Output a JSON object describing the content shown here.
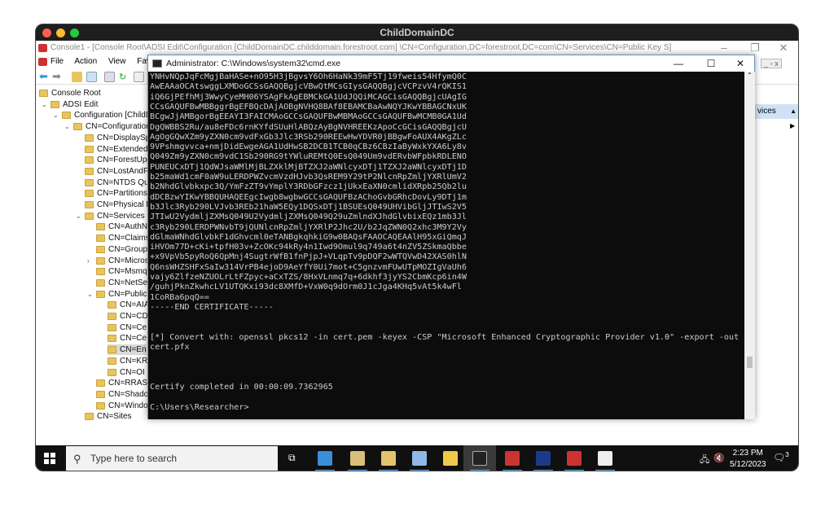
{
  "mac": {
    "title": "ChildDomainDC"
  },
  "console": {
    "title": "Console1 - [Console Root\\ADSI Edit\\Configuration [ChildDomainDC.childdomain.forestroot.com] \\CN=Configuration,DC=forestroot,DC=com\\CN=Services\\CN=Public Key S]",
    "menu": [
      "File",
      "Action",
      "View",
      "Favor"
    ],
    "right_panel_header": "vices",
    "tree": [
      {
        "label": "Console Root",
        "indent": 0,
        "chev": ""
      },
      {
        "label": "ADSI Edit",
        "indent": 1,
        "chev": "v"
      },
      {
        "label": "Configuration [ChildDomainDC",
        "indent": 2,
        "chev": "v"
      },
      {
        "label": "CN=Configuration",
        "indent": 3,
        "chev": "v"
      },
      {
        "label": "CN=DisplaySp",
        "indent": 4,
        "chev": ""
      },
      {
        "label": "CN=Extended-",
        "indent": 4,
        "chev": ""
      },
      {
        "label": "CN=ForestUpd",
        "indent": 4,
        "chev": ""
      },
      {
        "label": "CN=LostAndF",
        "indent": 4,
        "chev": ""
      },
      {
        "label": "CN=NTDS Quo",
        "indent": 4,
        "chev": ""
      },
      {
        "label": "CN=Partitions",
        "indent": 4,
        "chev": ""
      },
      {
        "label": "CN=Physical L",
        "indent": 4,
        "chev": ""
      },
      {
        "label": "CN=Services",
        "indent": 4,
        "chev": "v"
      },
      {
        "label": "CN=AuthN",
        "indent": 5,
        "chev": ""
      },
      {
        "label": "CN=Claims",
        "indent": 5,
        "chev": ""
      },
      {
        "label": "CN=Group",
        "indent": 5,
        "chev": ""
      },
      {
        "label": "CN=Micros",
        "indent": 5,
        "chev": ">"
      },
      {
        "label": "CN=Msmq",
        "indent": 5,
        "chev": ""
      },
      {
        "label": "CN=NetSer",
        "indent": 5,
        "chev": ""
      },
      {
        "label": "CN=Public",
        "indent": 5,
        "chev": "v"
      },
      {
        "label": "CN=AIA",
        "indent": 6,
        "chev": ""
      },
      {
        "label": "CN=CD",
        "indent": 6,
        "chev": ""
      },
      {
        "label": "CN=Ce",
        "indent": 6,
        "chev": ""
      },
      {
        "label": "CN=Ce",
        "indent": 6,
        "chev": ""
      },
      {
        "label": "CN=En",
        "indent": 6,
        "chev": "",
        "selected": true
      },
      {
        "label": "CN=KR",
        "indent": 6,
        "chev": ""
      },
      {
        "label": "CN=OI",
        "indent": 6,
        "chev": ""
      },
      {
        "label": "CN=RRAS",
        "indent": 5,
        "chev": ""
      },
      {
        "label": "CN=Shado",
        "indent": 5,
        "chev": ""
      },
      {
        "label": "CN=Windo",
        "indent": 5,
        "chev": ""
      },
      {
        "label": "CN=Sites",
        "indent": 4,
        "chev": ""
      }
    ]
  },
  "cmd": {
    "title": "Administrator: C:\\Windows\\system32\\cmd.exe",
    "lines": [
      "YNHvNQpJqFcMgjBaHASe+nO95H3jBgvsY6Oh6HaNk39mF5Tj19fweis54HfymQ0C",
      "AwEAAaOCAtswggLXMDoGCSsGAQQBgjcVBwQtMCsGIysGAQQBgjcVCPzvV4rQKIS1",
      "iQ6GjPEfhMj3WwyCyeMH06YSAgFkAgEBMCkGA1UdJQQiMCAGCisGAQQBgjcUAgIG",
      "CCsGAQUFBwMBBggrBgEFBQcDAjAOBgNVHQ8BAf8EBAMCBaAwNQYJKwYBBAGCNxUK",
      "BCgwJjAMBgorBgEEAYI3FAICMAoGCCsGAQUFBwMBMAoGCCsGAQUFBwMCMB0GA1Ud",
      "DgQWBBS2Ru/au8eFDc6rnKYfdSUuHlABQzAyBgNVHREEKzApoCcGCisGAQQBgjcU",
      "AgOgGQwXZm9yZXN0cm9vdFxGb3Jlc3RSb290REEwHwYDVR0jBBgwFoAUX4AKgZLc",
      "9VPshmgvvca+nmjDidEwgeAGA1UdHwSB2DCB1TCB0qCBz6CBzIaByWxkYXA6Ly8v",
      "Q049Zm9yZXN0cm9vdC1Sb290RG9tYWluREMtQ0EsQ049Um9vdERvbWFpbkRDLENO",
      "PUNEUCxDTj1QdWJsaWMlMjBLZXklMjBTZXJ2aWNlcyxDTj1TZXJ2aWNlcyxDTj1D",
      "b25maWd1cmF0aW9uLERDPWZvcmVzdHJvb3QsREM9Y29tP2NlcnRpZmljYXRlUmV2",
      "b2NhdGlvbkxpc3Q/YmFzZT9vYmplY3RDbGFzcz1jUkxEaXN0cmlidXRpb25Qb2lu",
      "dDCBzwYIKwYBBQUHAQEEgcIwgb8wgbwGCCsGAQUFBzAChoGvbGRhcDovLy9DTj1m",
      "b3Jlc3Ryb290LVJvb3REb21haW5EQy1DQSxDTj1BSUEsQ049UHVibGljJTIwS2V5",
      "JTIwU2VydmljZXMsQ049U2VydmljZXMsQ049Q29uZmlndXJhdGlvbixEQz1mb3Jl",
      "c3Ryb290LERDPWNvbT9jQUNlcnRpZmljYXRlP2Jhc2U/b2JqZWN0Q2xhc3M9Y2Vy",
      "dGlmaWNhdGlvbkF1dGhvcml0eTANBgkqhkiG9w0BAQsFAAOCAQEAAlH95xGiQmqJ",
      "iHVOm77D+cKi+tpfH03v+ZcOKc94kRy4n1Iwd9Omul9q749a6t4nZV5ZSkmaQbbe",
      "+x9VpVb5pyRoQ6QpMnj4SugtrWfB1fnPjpJ+VLqpTv9pDQF2wWTQVwD42XAS0hlN",
      "Q6nsWHZSHFxSaIw314VrPB4ejoD9AeYfY0Ui7mot+C5gnzvmFUwUTpMOZIgVaUh6",
      "vajy6ZlfzeNZUOLrLtFZpyc+aCxTZS/8HxVLnmq7q+6dkhf3jyYS2CbmKcp6in4W",
      "/guhjPknZkwhcLV1UTQKxi93dc8XMfD+VxW0q9dOrm0J1cJga4KHq5vAt5k4wFl",
      "1CoRBa6pqQ==",
      "-----END CERTIFICATE-----",
      "",
      "",
      "[*] Convert with: openssl pkcs12 -in cert.pem -keyex -CSP \"Microsoft Enhanced Cryptographic Provider v1.0\" -export -out",
      "cert.pfx",
      "",
      "",
      "",
      "Certify completed in 00:00:09.7362965",
      "",
      "C:\\Users\\Researcher>"
    ]
  },
  "taskbar": {
    "search_placeholder": "Type here to search",
    "time": "2:23 PM",
    "date": "5/12/2023",
    "notification_count": "3"
  }
}
